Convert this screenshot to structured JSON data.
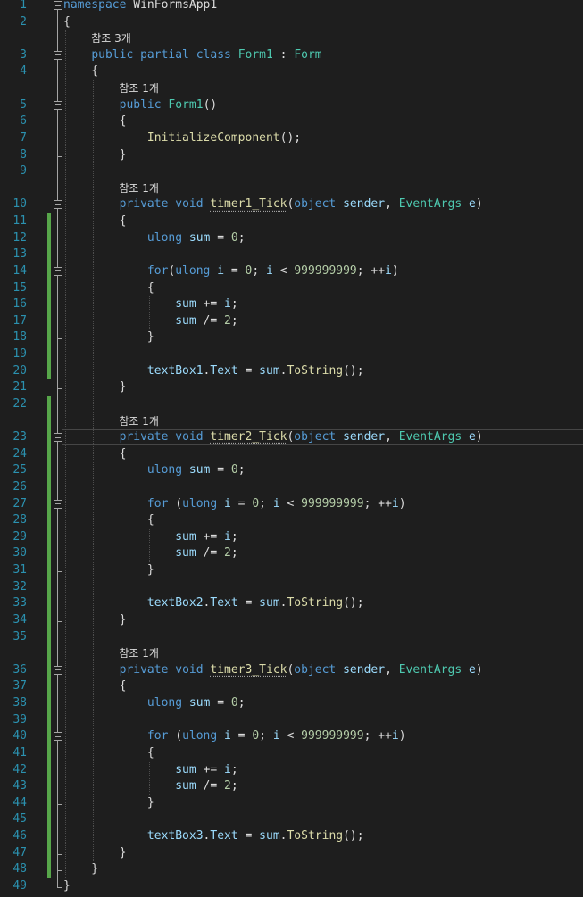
{
  "editor": {
    "colors": {
      "background": "#1e1e1e",
      "line_number": "#2b91af",
      "keyword": "#569cd6",
      "type": "#4ec9b0",
      "method": "#dcdcaa",
      "identifier": "#9cdcfe",
      "number": "#b5cea8",
      "plain": "#dcdcdc",
      "codelens": "#999999",
      "change_marker": "#57a64a"
    },
    "current_line": 23,
    "rows": [
      {
        "ln": "1",
        "fold": true,
        "tokens": [
          {
            "t": "namespace",
            "c": "kw"
          },
          {
            "t": " WinFormsApp1",
            "c": "pl"
          }
        ]
      },
      {
        "ln": "2",
        "tokens": [
          {
            "t": "{",
            "c": "pl"
          }
        ]
      },
      {
        "lens": "참조 3개",
        "indent": 4
      },
      {
        "ln": "3",
        "fold": true,
        "tokens": [
          {
            "t": "    "
          },
          {
            "t": "public partial class",
            "c": "kw"
          },
          {
            "t": " "
          },
          {
            "t": "Form1",
            "c": "ty"
          },
          {
            "t": " : "
          },
          {
            "t": "Form",
            "c": "ty"
          }
        ]
      },
      {
        "ln": "4",
        "tokens": [
          {
            "t": "    {"
          }
        ]
      },
      {
        "lens": "참조 1개",
        "indent": 8
      },
      {
        "ln": "5",
        "fold": true,
        "tokens": [
          {
            "t": "        "
          },
          {
            "t": "public",
            "c": "kw"
          },
          {
            "t": " "
          },
          {
            "t": "Form1",
            "c": "ty"
          },
          {
            "t": "()"
          }
        ]
      },
      {
        "ln": "6",
        "tokens": [
          {
            "t": "        {"
          }
        ]
      },
      {
        "ln": "7",
        "tokens": [
          {
            "t": "            "
          },
          {
            "t": "InitializeComponent",
            "c": "fn"
          },
          {
            "t": "();"
          }
        ]
      },
      {
        "ln": "8",
        "tokens": [
          {
            "t": "        }"
          }
        ]
      },
      {
        "ln": "9",
        "tokens": []
      },
      {
        "lens": "참조 1개",
        "indent": 8
      },
      {
        "ln": "10",
        "fold": true,
        "tokens": [
          {
            "t": "        "
          },
          {
            "t": "private void",
            "c": "kw"
          },
          {
            "t": " "
          },
          {
            "t": "timer1_Tick",
            "c": "fn",
            "sq": true
          },
          {
            "t": "("
          },
          {
            "t": "object",
            "c": "kw"
          },
          {
            "t": " "
          },
          {
            "t": "sender",
            "c": "vr"
          },
          {
            "t": ", "
          },
          {
            "t": "EventArgs",
            "c": "ty"
          },
          {
            "t": " "
          },
          {
            "t": "e",
            "c": "vr"
          },
          {
            "t": ")"
          }
        ]
      },
      {
        "ln": "11",
        "tokens": [
          {
            "t": "        {"
          }
        ]
      },
      {
        "ln": "12",
        "tokens": [
          {
            "t": "            "
          },
          {
            "t": "ulong",
            "c": "kw"
          },
          {
            "t": " "
          },
          {
            "t": "sum",
            "c": "vr"
          },
          {
            "t": " = "
          },
          {
            "t": "0",
            "c": "nm"
          },
          {
            "t": ";"
          }
        ]
      },
      {
        "ln": "13",
        "tokens": []
      },
      {
        "ln": "14",
        "fold": true,
        "tokens": [
          {
            "t": "            "
          },
          {
            "t": "for",
            "c": "kw"
          },
          {
            "t": "("
          },
          {
            "t": "ulong",
            "c": "kw"
          },
          {
            "t": " "
          },
          {
            "t": "i",
            "c": "vr"
          },
          {
            "t": " = "
          },
          {
            "t": "0",
            "c": "nm"
          },
          {
            "t": "; "
          },
          {
            "t": "i",
            "c": "vr"
          },
          {
            "t": " < "
          },
          {
            "t": "999999999",
            "c": "nm"
          },
          {
            "t": "; ++"
          },
          {
            "t": "i",
            "c": "vr"
          },
          {
            "t": ")"
          }
        ]
      },
      {
        "ln": "15",
        "tokens": [
          {
            "t": "            {"
          }
        ]
      },
      {
        "ln": "16",
        "tokens": [
          {
            "t": "                "
          },
          {
            "t": "sum",
            "c": "vr"
          },
          {
            "t": " += "
          },
          {
            "t": "i",
            "c": "vr"
          },
          {
            "t": ";"
          }
        ]
      },
      {
        "ln": "17",
        "tokens": [
          {
            "t": "                "
          },
          {
            "t": "sum",
            "c": "vr"
          },
          {
            "t": " /= "
          },
          {
            "t": "2",
            "c": "nm"
          },
          {
            "t": ";"
          }
        ]
      },
      {
        "ln": "18",
        "tokens": [
          {
            "t": "            }"
          }
        ]
      },
      {
        "ln": "19",
        "tokens": []
      },
      {
        "ln": "20",
        "tokens": [
          {
            "t": "            "
          },
          {
            "t": "textBox1",
            "c": "vr"
          },
          {
            "t": "."
          },
          {
            "t": "Text",
            "c": "vr"
          },
          {
            "t": " = "
          },
          {
            "t": "sum",
            "c": "vr"
          },
          {
            "t": "."
          },
          {
            "t": "ToString",
            "c": "fn"
          },
          {
            "t": "();"
          }
        ]
      },
      {
        "ln": "21",
        "tokens": [
          {
            "t": "        }"
          }
        ]
      },
      {
        "ln": "22",
        "tokens": []
      },
      {
        "lens": "참조 1개",
        "indent": 8
      },
      {
        "ln": "23",
        "fold": true,
        "tokens": [
          {
            "t": "        "
          },
          {
            "t": "private void",
            "c": "kw"
          },
          {
            "t": " "
          },
          {
            "t": "timer2_Tick",
            "c": "fn",
            "sq": true
          },
          {
            "t": "("
          },
          {
            "t": "object",
            "c": "kw"
          },
          {
            "t": " "
          },
          {
            "t": "sender",
            "c": "vr"
          },
          {
            "t": ", "
          },
          {
            "t": "EventArgs",
            "c": "ty"
          },
          {
            "t": " "
          },
          {
            "t": "e",
            "c": "vr"
          },
          {
            "t": ")"
          }
        ]
      },
      {
        "ln": "24",
        "tokens": [
          {
            "t": "        {"
          }
        ]
      },
      {
        "ln": "25",
        "tokens": [
          {
            "t": "            "
          },
          {
            "t": "ulong",
            "c": "kw"
          },
          {
            "t": " "
          },
          {
            "t": "sum",
            "c": "vr"
          },
          {
            "t": " = "
          },
          {
            "t": "0",
            "c": "nm"
          },
          {
            "t": ";"
          }
        ]
      },
      {
        "ln": "26",
        "tokens": []
      },
      {
        "ln": "27",
        "fold": true,
        "tokens": [
          {
            "t": "            "
          },
          {
            "t": "for",
            "c": "kw"
          },
          {
            "t": " ("
          },
          {
            "t": "ulong",
            "c": "kw"
          },
          {
            "t": " "
          },
          {
            "t": "i",
            "c": "vr"
          },
          {
            "t": " = "
          },
          {
            "t": "0",
            "c": "nm"
          },
          {
            "t": "; "
          },
          {
            "t": "i",
            "c": "vr"
          },
          {
            "t": " < "
          },
          {
            "t": "999999999",
            "c": "nm"
          },
          {
            "t": "; ++"
          },
          {
            "t": "i",
            "c": "vr"
          },
          {
            "t": ")"
          }
        ]
      },
      {
        "ln": "28",
        "tokens": [
          {
            "t": "            {"
          }
        ]
      },
      {
        "ln": "29",
        "tokens": [
          {
            "t": "                "
          },
          {
            "t": "sum",
            "c": "vr"
          },
          {
            "t": " += "
          },
          {
            "t": "i",
            "c": "vr"
          },
          {
            "t": ";"
          }
        ]
      },
      {
        "ln": "30",
        "tokens": [
          {
            "t": "                "
          },
          {
            "t": "sum",
            "c": "vr"
          },
          {
            "t": " /= "
          },
          {
            "t": "2",
            "c": "nm"
          },
          {
            "t": ";"
          }
        ]
      },
      {
        "ln": "31",
        "tokens": [
          {
            "t": "            }"
          }
        ]
      },
      {
        "ln": "32",
        "tokens": []
      },
      {
        "ln": "33",
        "tokens": [
          {
            "t": "            "
          },
          {
            "t": "textBox2",
            "c": "vr"
          },
          {
            "t": "."
          },
          {
            "t": "Text",
            "c": "vr"
          },
          {
            "t": " = "
          },
          {
            "t": "sum",
            "c": "vr"
          },
          {
            "t": "."
          },
          {
            "t": "ToString",
            "c": "fn"
          },
          {
            "t": "();"
          }
        ]
      },
      {
        "ln": "34",
        "tokens": [
          {
            "t": "        }"
          }
        ]
      },
      {
        "ln": "35",
        "tokens": []
      },
      {
        "lens": "참조 1개",
        "indent": 8
      },
      {
        "ln": "36",
        "fold": true,
        "tokens": [
          {
            "t": "        "
          },
          {
            "t": "private void",
            "c": "kw"
          },
          {
            "t": " "
          },
          {
            "t": "timer3_Tick",
            "c": "fn",
            "sq": true
          },
          {
            "t": "("
          },
          {
            "t": "object",
            "c": "kw"
          },
          {
            "t": " "
          },
          {
            "t": "sender",
            "c": "vr"
          },
          {
            "t": ", "
          },
          {
            "t": "EventArgs",
            "c": "ty"
          },
          {
            "t": " "
          },
          {
            "t": "e",
            "c": "vr"
          },
          {
            "t": ")"
          }
        ]
      },
      {
        "ln": "37",
        "tokens": [
          {
            "t": "        {"
          }
        ]
      },
      {
        "ln": "38",
        "tokens": [
          {
            "t": "            "
          },
          {
            "t": "ulong",
            "c": "kw"
          },
          {
            "t": " "
          },
          {
            "t": "sum",
            "c": "vr"
          },
          {
            "t": " = "
          },
          {
            "t": "0",
            "c": "nm"
          },
          {
            "t": ";"
          }
        ]
      },
      {
        "ln": "39",
        "tokens": []
      },
      {
        "ln": "40",
        "fold": true,
        "tokens": [
          {
            "t": "            "
          },
          {
            "t": "for",
            "c": "kw"
          },
          {
            "t": " ("
          },
          {
            "t": "ulong",
            "c": "kw"
          },
          {
            "t": " "
          },
          {
            "t": "i",
            "c": "vr"
          },
          {
            "t": " = "
          },
          {
            "t": "0",
            "c": "nm"
          },
          {
            "t": "; "
          },
          {
            "t": "i",
            "c": "vr"
          },
          {
            "t": " < "
          },
          {
            "t": "999999999",
            "c": "nm"
          },
          {
            "t": "; ++"
          },
          {
            "t": "i",
            "c": "vr"
          },
          {
            "t": ")"
          }
        ]
      },
      {
        "ln": "41",
        "tokens": [
          {
            "t": "            {"
          }
        ]
      },
      {
        "ln": "42",
        "tokens": [
          {
            "t": "                "
          },
          {
            "t": "sum",
            "c": "vr"
          },
          {
            "t": " += "
          },
          {
            "t": "i",
            "c": "vr"
          },
          {
            "t": ";"
          }
        ]
      },
      {
        "ln": "43",
        "tokens": [
          {
            "t": "                "
          },
          {
            "t": "sum",
            "c": "vr"
          },
          {
            "t": " /= "
          },
          {
            "t": "2",
            "c": "nm"
          },
          {
            "t": ";"
          }
        ]
      },
      {
        "ln": "44",
        "tokens": [
          {
            "t": "            }"
          }
        ]
      },
      {
        "ln": "45",
        "tokens": []
      },
      {
        "ln": "46",
        "tokens": [
          {
            "t": "            "
          },
          {
            "t": "textBox3",
            "c": "vr"
          },
          {
            "t": "."
          },
          {
            "t": "Text",
            "c": "vr"
          },
          {
            "t": " = "
          },
          {
            "t": "sum",
            "c": "vr"
          },
          {
            "t": "."
          },
          {
            "t": "ToString",
            "c": "fn"
          },
          {
            "t": "();"
          }
        ]
      },
      {
        "ln": "47",
        "tokens": [
          {
            "t": "        }"
          }
        ]
      },
      {
        "ln": "48",
        "tokens": [
          {
            "t": "    }"
          }
        ]
      },
      {
        "ln": "49",
        "tokens": [
          {
            "t": "}"
          }
        ]
      }
    ]
  }
}
